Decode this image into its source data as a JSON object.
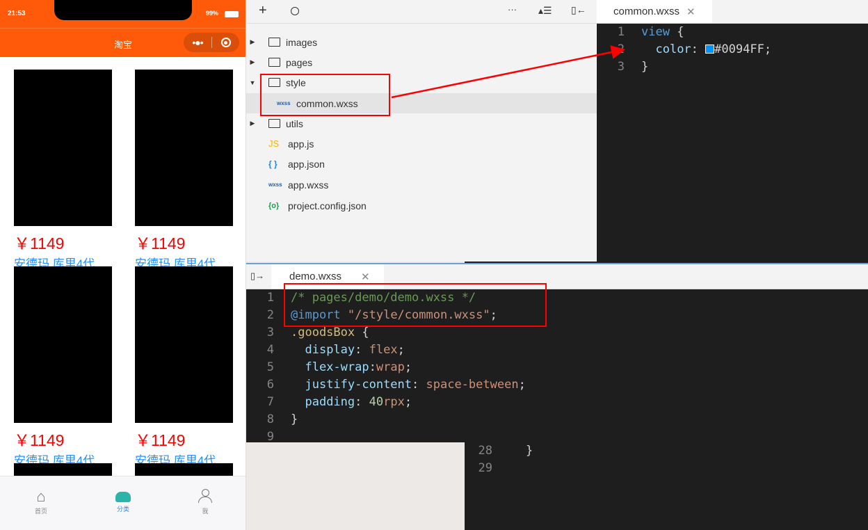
{
  "phone": {
    "time": "21:53",
    "battery": "99%",
    "title": "淘宝",
    "goods": [
      {
        "price": "￥1149",
        "title": "安德玛 库里4代 ..."
      },
      {
        "price": "￥1149",
        "title": "安德玛 库里4代 ..."
      },
      {
        "price": "￥1149",
        "title": "安德玛 库里4代 ..."
      },
      {
        "price": "￥1149",
        "title": "安德玛 库里4代 ..."
      }
    ],
    "tabs": [
      {
        "label": "首页"
      },
      {
        "label": "分类"
      },
      {
        "label": "我"
      }
    ],
    "accent": "#ff5a0a"
  },
  "tree": {
    "items": [
      {
        "label": "images",
        "type": "folder"
      },
      {
        "label": "pages",
        "type": "folder"
      },
      {
        "label": "style",
        "type": "folder-open"
      },
      {
        "label": "common.wxss",
        "badge": "wxss"
      },
      {
        "label": "utils",
        "type": "folder"
      },
      {
        "label": "app.js",
        "badge": "JS"
      },
      {
        "label": "app.json",
        "badge": "{ }"
      },
      {
        "label": "app.wxss",
        "badge": "wxss"
      },
      {
        "label": "project.config.json",
        "badge": "{o}"
      }
    ]
  },
  "common_editor": {
    "tab": "common.wxss",
    "lines": [
      "1",
      "2",
      "3"
    ],
    "code": {
      "sel": "view",
      "open": "{",
      "prop": "color",
      "value": "#0094FF",
      "close": "}"
    },
    "swatch": "#0094FF"
  },
  "demo_editor": {
    "tab": "demo.wxss",
    "lines": [
      "1",
      "2",
      "3",
      "4",
      "5",
      "6",
      "7",
      "8",
      "9"
    ],
    "comment": "/* pages/demo/demo.wxss */",
    "import_kw": "@import",
    "import_path": "\"/style/common.wxss\"",
    "selector": ".goodsBox",
    "props": [
      {
        "p": "display",
        "v": "flex"
      },
      {
        "p": "flex-wrap",
        "v": "wrap"
      },
      {
        "p": "justify-content",
        "v": "space-between"
      },
      {
        "p": "padding",
        "v": "40",
        "u": "rpx"
      }
    ]
  },
  "back_editor": {
    "lines": [
      "28",
      "29"
    ],
    "brace": "}"
  }
}
